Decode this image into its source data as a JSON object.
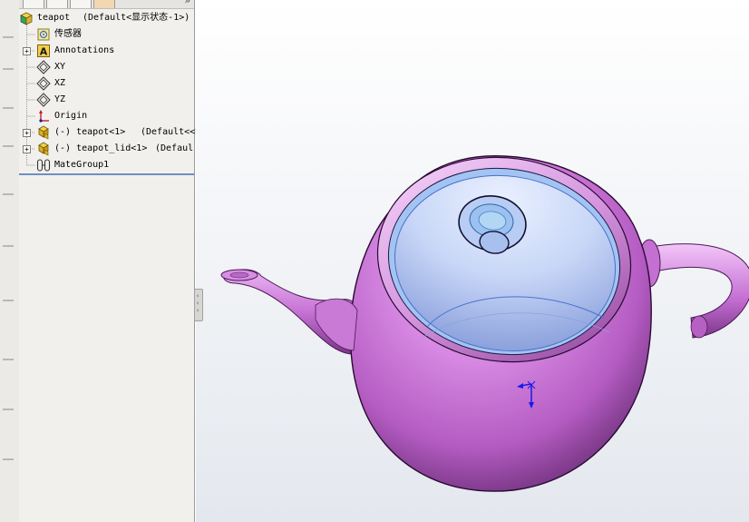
{
  "feature_tree": {
    "root": {
      "name": "teapot",
      "config": "(Default<显示状态-1>)"
    },
    "items": [
      {
        "label": "传感器",
        "expandable": false
      },
      {
        "label": "Annotations",
        "expandable": true
      },
      {
        "label": "XY",
        "expandable": false
      },
      {
        "label": "XZ",
        "expandable": false
      },
      {
        "label": "YZ",
        "expandable": false
      },
      {
        "label": "Origin",
        "expandable": false
      },
      {
        "label": "(-) teapot<1>",
        "suffix": "(Default<<D",
        "expandable": true
      },
      {
        "label": "(-) teapot_lid<1>",
        "suffix": "(Defaul",
        "expandable": true
      },
      {
        "label": "MateGroup1",
        "expandable": false
      }
    ]
  },
  "colors": {
    "model_body": "#b85cc6",
    "model_highlight": "#f0c8f6",
    "model_inner": "#8fb0e8",
    "triad": "#1a1ae6"
  },
  "icons": [
    "assembly-icon",
    "sensor-icon",
    "annotation-icon",
    "plane-icon",
    "origin-icon",
    "part-icon",
    "mate-group-icon"
  ]
}
